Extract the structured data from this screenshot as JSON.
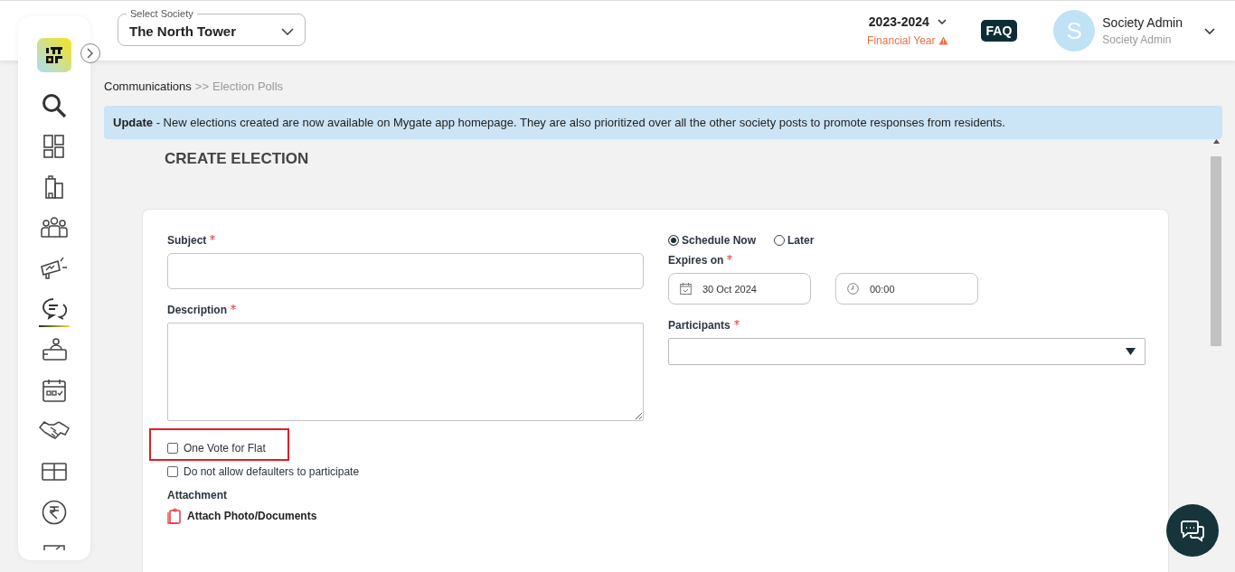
{
  "header": {
    "society_select": {
      "label": "Select Society",
      "value": "The North Tower"
    },
    "financial_year": {
      "value": "2023-2024",
      "label": "Financial Year"
    },
    "faq": "FAQ",
    "user": {
      "initial": "S",
      "name": "Society Admin",
      "role": "Society Admin"
    }
  },
  "sidebar": {
    "items": [
      {
        "kind": "search",
        "selected": false
      },
      {
        "kind": "dashboard",
        "selected": false
      },
      {
        "kind": "building",
        "selected": false
      },
      {
        "kind": "people",
        "selected": false
      },
      {
        "kind": "megaphone",
        "selected": false
      },
      {
        "kind": "chat",
        "selected": true
      },
      {
        "kind": "reception",
        "selected": false
      },
      {
        "kind": "calendar",
        "selected": false
      },
      {
        "kind": "handshake",
        "selected": false
      },
      {
        "kind": "box",
        "selected": false
      },
      {
        "kind": "rupee",
        "selected": false
      },
      {
        "kind": "partial",
        "selected": false
      }
    ]
  },
  "breadcrumb": {
    "parent": "Communications",
    "separator": ">>",
    "current": "Election Polls"
  },
  "notice": "**Update** - New elections created are now available on Mygate app homepage. They are also prioritized over all the other society posts to promote responses from residents.",
  "page_title": "CREATE ELECTION",
  "form": {
    "subject": {
      "label": "Subject",
      "required": true
    },
    "description": {
      "label": "Description",
      "required": true
    },
    "options": [
      {
        "label": "One Vote for Flat",
        "checked": false,
        "highlighted": true
      },
      {
        "label": "Do not allow defaulters to participate",
        "checked": false,
        "highlighted": false
      }
    ],
    "attachment": {
      "label": "Attachment",
      "link": "Attach Photo/Documents"
    },
    "schedule": [
      {
        "label": "Schedule Now",
        "selected": true
      },
      {
        "label": "Later",
        "selected": false
      }
    ],
    "expires_on": {
      "label": "Expires on",
      "required": true,
      "date": "30 Oct 2024",
      "time": "00:00"
    },
    "participants": {
      "label": "Participants",
      "required": true
    }
  }
}
